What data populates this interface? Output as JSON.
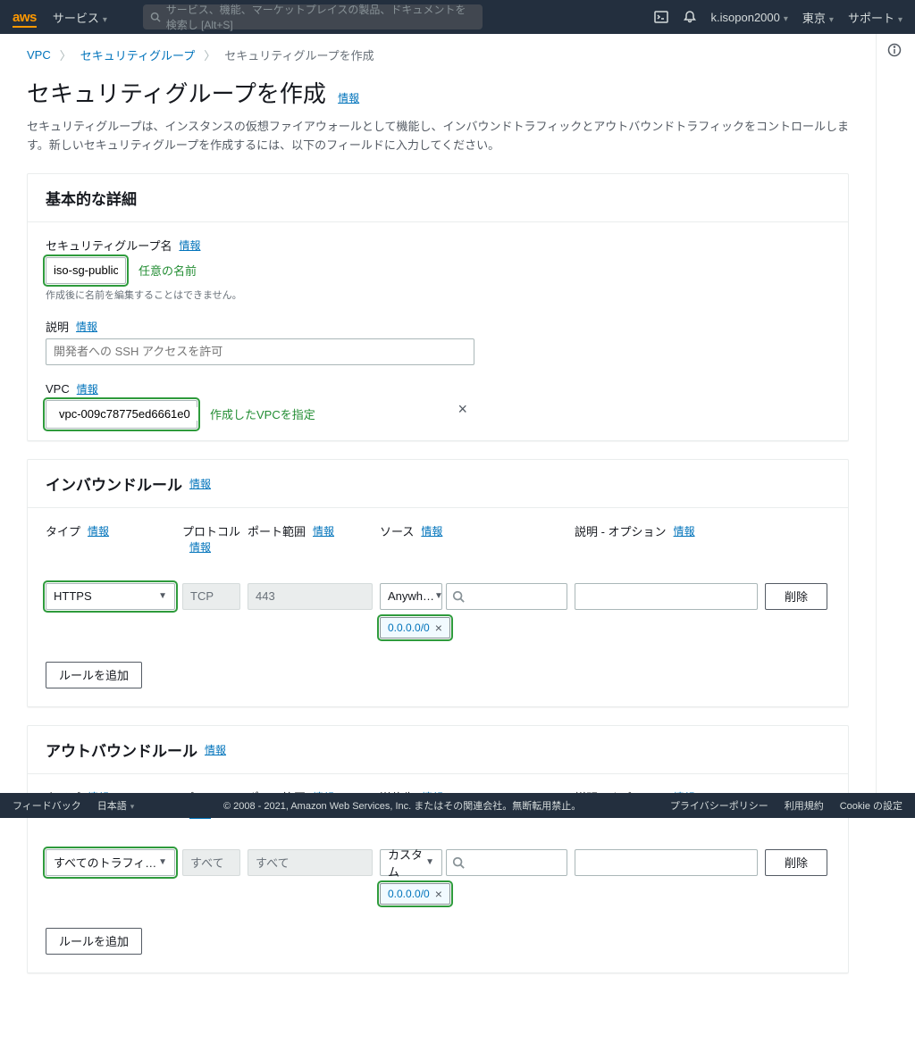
{
  "topnav": {
    "logo": "aws",
    "services": "サービス",
    "search_placeholder": "サービス、機能、マーケットプレイスの製品、ドキュメントを検索し   [Alt+S]",
    "account": "k.isopon2000",
    "region": "東京",
    "support": "サポート"
  },
  "breadcrumb": {
    "vpc": "VPC",
    "sg": "セキュリティグループ",
    "current": "セキュリティグループを作成"
  },
  "heading": {
    "title": "セキュリティグループを作成",
    "info": "情報"
  },
  "description": "セキュリティグループは、インスタンスの仮想ファイアウォールとして機能し、インバウンドトラフィックとアウトバウンドトラフィックをコントロールします。新しいセキュリティグループを作成するには、以下のフィールドに入力してください。",
  "basic": {
    "header": "基本的な詳細",
    "name_label": "セキュリティグループ名",
    "name_info": "情報",
    "name_value": "iso-sg-public",
    "name_annot": "任意の名前",
    "name_help": "作成後に名前を編集することはできません。",
    "desc_label": "説明",
    "desc_info": "情報",
    "desc_placeholder": "開発者への SSH アクセスを許可",
    "vpc_label": "VPC",
    "vpc_info": "情報",
    "vpc_value": "vpc-009c78775ed6661e0",
    "vpc_annot": "作成したVPCを指定"
  },
  "inbound": {
    "header": "インバウンドルール",
    "header_info": "情報",
    "cols": {
      "type": "タイプ",
      "type_info": "情報",
      "proto": "プロトコル",
      "proto_info": "情報",
      "port": "ポート範囲",
      "port_info": "情報",
      "source": "ソース",
      "source_info": "情報",
      "desc": "説明 - オプション",
      "desc_info": "情報"
    },
    "row": {
      "type": "HTTPS",
      "proto": "TCP",
      "port": "443",
      "source_type": "Anywh…",
      "cidr": "0.0.0.0/0",
      "delete": "削除"
    },
    "add": "ルールを追加"
  },
  "outbound": {
    "header": "アウトバウンドルール",
    "header_info": "情報",
    "cols": {
      "type": "タイプ",
      "type_info": "情報",
      "proto": "プロトコル",
      "proto_info": "情報",
      "port": "ポート範囲",
      "port_info": "情報",
      "dest": "送信先",
      "dest_info": "情報",
      "desc": "説明 - オプション",
      "desc_info": "情報"
    },
    "row": {
      "type": "すべてのトラフィ…",
      "proto": "すべて",
      "port": "すべて",
      "dest_type": "カスタム",
      "cidr": "0.0.0.0/0",
      "delete": "削除"
    },
    "add": "ルールを追加"
  },
  "footer": {
    "feedback": "フィードバック",
    "language": "日本語",
    "copyright": "© 2008 - 2021, Amazon Web Services, Inc. またはその関連会社。無断転用禁止。",
    "privacy": "プライバシーポリシー",
    "terms": "利用規約",
    "cookie": "Cookie の設定"
  }
}
